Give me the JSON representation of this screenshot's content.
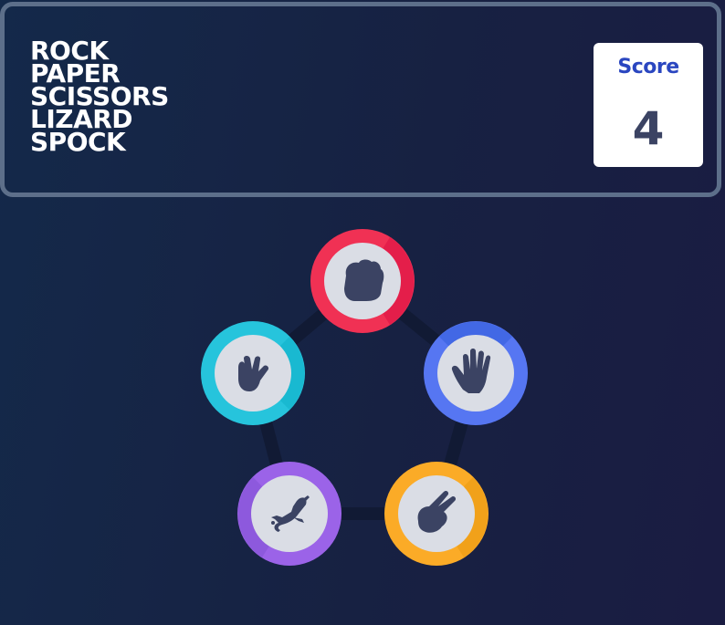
{
  "header": {
    "title_lines": [
      "ROCK",
      "PAPER",
      "SCISSORS",
      "LIZARD",
      "SPOCK"
    ]
  },
  "score": {
    "label": "Score",
    "value": "4"
  },
  "choices": [
    {
      "name": "rock",
      "icon": "rock-fist-icon",
      "color": "#f03154",
      "dark": "#dc1245"
    },
    {
      "name": "paper",
      "icon": "paper-hand-icon",
      "color": "#5676f2",
      "dark": "#3b63e0"
    },
    {
      "name": "scissors",
      "icon": "scissors-hand-icon",
      "color": "#fbab27",
      "dark": "#ec9c16"
    },
    {
      "name": "lizard",
      "icon": "lizard-hand-icon",
      "color": "#9b63e8",
      "dark": "#8855d9"
    },
    {
      "name": "spock",
      "icon": "spock-hand-icon",
      "color": "#26c4dc",
      "dark": "#14b5cc"
    }
  ],
  "colors": {
    "icon_fill": "#3b4363",
    "token_face": "#dadde5",
    "pentagon_line": "#111a34",
    "header_border": "#5d6f8a"
  }
}
